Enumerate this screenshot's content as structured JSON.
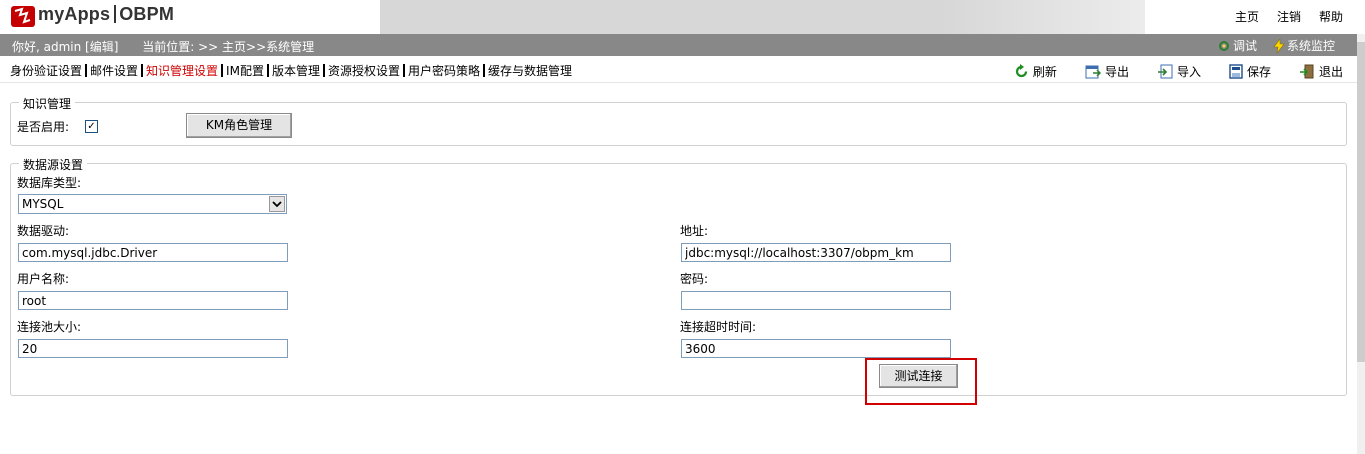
{
  "header": {
    "logo_text": "myApps",
    "product": "OBPM",
    "links": [
      "主页",
      "注销",
      "帮助"
    ]
  },
  "status": {
    "greeting": "你好, admin [编辑]",
    "location": "当前位置: >> 主页>>系统管理",
    "actions": {
      "debug": "调试",
      "monitor": "系统监控"
    }
  },
  "tabs": [
    {
      "label": "身份验证设置"
    },
    {
      "label": "邮件设置"
    },
    {
      "label": "知识管理设置",
      "active": true
    },
    {
      "label": "IM配置"
    },
    {
      "label": "版本管理"
    },
    {
      "label": "资源授权设置"
    },
    {
      "label": "用户密码策略"
    },
    {
      "label": "缓存与数据管理"
    }
  ],
  "toolbar": {
    "refresh": "刷新",
    "export": "导出",
    "import": "导入",
    "save": "保存",
    "exit": "退出"
  },
  "km": {
    "legend": "知识管理",
    "enable_label": "是否启用:",
    "enabled": "✓",
    "role_button": "KM角色管理"
  },
  "datasource": {
    "legend": "数据源设置",
    "db_type_label": "数据库类型:",
    "db_type_value": "MYSQL",
    "driver_label": "数据驱动:",
    "driver_value": "com.mysql.jdbc.Driver",
    "url_label": "地址:",
    "url_value": "jdbc:mysql://localhost:3307/obpm_km",
    "user_label": "用户名称:",
    "user_value": "root",
    "password_label": "密码:",
    "password_value": "",
    "pool_label": "连接池大小:",
    "pool_value": "20",
    "timeout_label": "连接超时时间:",
    "timeout_value": "3600",
    "test_button": "测试连接"
  },
  "colors": {
    "status_bar": "#888888",
    "active_tab": "#d00000",
    "highlight": "#d00000"
  }
}
